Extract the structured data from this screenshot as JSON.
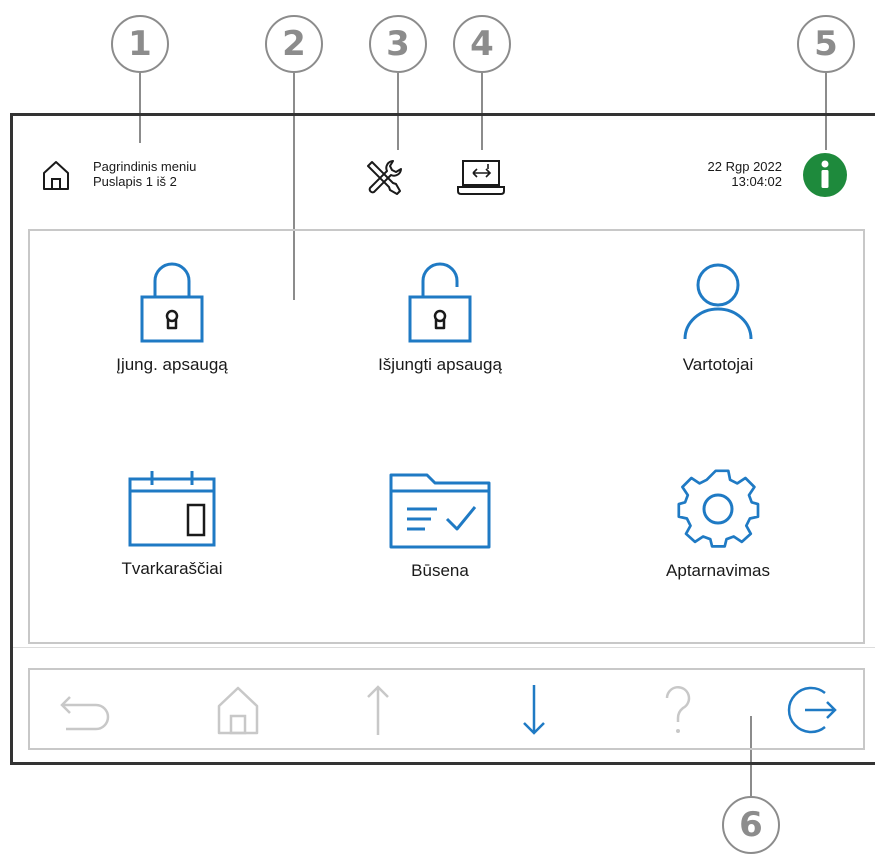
{
  "callouts": [
    "1",
    "2",
    "3",
    "4",
    "5",
    "6"
  ],
  "header": {
    "menu_title": "Pagrindinis meniu",
    "page_info": "Puslapis 1 iš 2",
    "date": "22 Rgp 2022",
    "time": "13:04:02",
    "icons": [
      "home-icon",
      "tools-icon",
      "laptop-transfer-icon",
      "info-icon"
    ]
  },
  "tiles": [
    {
      "label": "Įjung. apsaugą",
      "icon": "lock-closed-icon"
    },
    {
      "label": "Išjungti apsaugą",
      "icon": "lock-open-icon"
    },
    {
      "label": "Vartotojai",
      "icon": "user-icon"
    },
    {
      "label": "Tvarkaraščiai",
      "icon": "calendar-icon"
    },
    {
      "label": "Būsena",
      "icon": "folder-check-icon"
    },
    {
      "label": "Aptarnavimas",
      "icon": "gear-icon"
    }
  ],
  "nav": [
    {
      "icon": "back-icon",
      "enabled": false
    },
    {
      "icon": "home-icon",
      "enabled": false
    },
    {
      "icon": "arrow-up-icon",
      "enabled": false
    },
    {
      "icon": "arrow-down-icon",
      "enabled": true
    },
    {
      "icon": "help-icon",
      "enabled": false
    },
    {
      "icon": "logout-icon",
      "enabled": true
    }
  ],
  "colors": {
    "accent": "#1f7ac4",
    "info": "#1e8a3c",
    "disabled": "#c8c8c8",
    "frame": "#333333"
  }
}
